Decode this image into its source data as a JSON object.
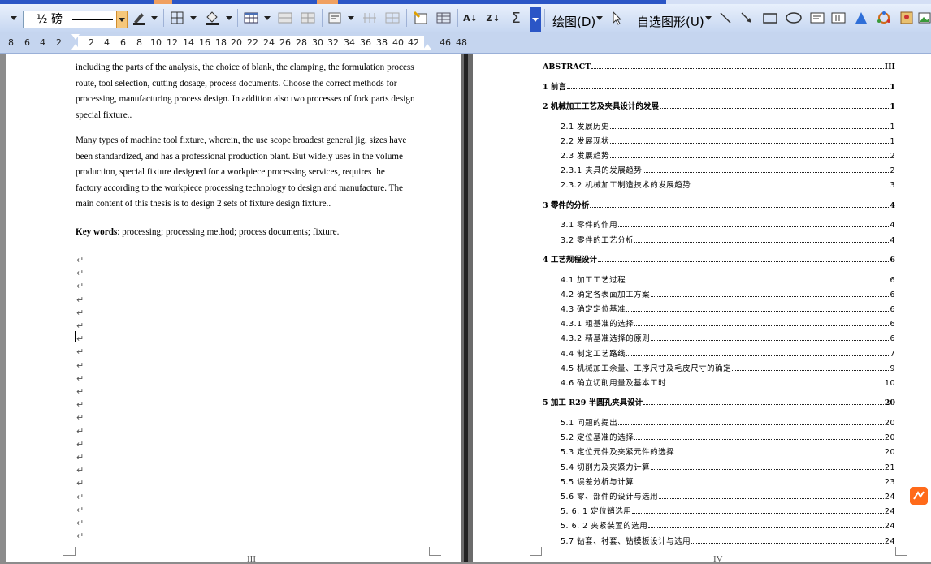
{
  "toolbar": {
    "font_size": "½ 磅",
    "draw_menu": "绘图(D)",
    "autoshapes_menu": "自选图形(U)"
  },
  "ruler": {
    "left_ticks": [
      "8",
      "6",
      "4",
      "2"
    ],
    "right_ticks": [
      "2",
      "4",
      "6",
      "8",
      "10",
      "12",
      "14",
      "16",
      "18",
      "20",
      "22",
      "24",
      "26",
      "28",
      "30",
      "32",
      "34",
      "36",
      "38",
      "40",
      "42",
      "46",
      "48"
    ]
  },
  "left_page": {
    "para1_lines": [
      "including the parts of the analysis, the choice of blank, the clamping, the formulation process",
      "route, tool selection, cutting dosage, process documents. Choose the correct methods for",
      "processing, manufacturing process design. In addition also two processes of fork parts design",
      "special fixture.."
    ],
    "para2_lines": [
      "Many types of machine tool fixture, wherein, the use scope broadest general jig, sizes have",
      "been standardized, and has a professional production plant. But widely uses in the volume",
      "production, special fixture designed for a    workpiece    processing services, requires the",
      "factory according to the    workpiece    processing technology to design and manufacture. The",
      "main content of this thesis is to design 2 sets of fixture design fixture.."
    ],
    "keywords_label": "Key words",
    "keywords_text": ": processing; processing method; process documents; fixture.",
    "return_mark": "↵",
    "page_number": "III"
  },
  "right_page": {
    "page_number": "IV",
    "toc": [
      {
        "title": "ABSTRACT",
        "page": "III",
        "level": 1
      },
      {
        "title": "1 前言",
        "page": "1",
        "level": 1
      },
      {
        "title": "2   机械加工工艺及夹具设计的发展",
        "page": "1",
        "level": 1
      },
      {
        "title": "2.1  发展历史",
        "page": "1",
        "level": 2
      },
      {
        "title": "2.2  发展现状",
        "page": "1",
        "level": 2
      },
      {
        "title": "2.3  发展趋势",
        "page": "2",
        "level": 2
      },
      {
        "title": "2.3.1 夹具的发展趋势",
        "page": "2",
        "level": 2
      },
      {
        "title": "2.3.2 机械加工制造技术的发展趋势",
        "page": "3",
        "level": 2
      },
      {
        "title": "3  零件的分析",
        "page": "4",
        "level": 1
      },
      {
        "title": "3.1  零件的作用",
        "page": "4",
        "level": 2
      },
      {
        "title": "3.2  零件的工艺分析",
        "page": "4",
        "level": 2
      },
      {
        "title": "4   工艺规程设计",
        "page": "6",
        "level": 1
      },
      {
        "title": "4.1  加工工艺过程",
        "page": "6",
        "level": 2
      },
      {
        "title": "4.2 确定各表面加工方案",
        "page": "6",
        "level": 2
      },
      {
        "title": "4.3  确定定位基准",
        "page": "6",
        "level": 2
      },
      {
        "title": "4.3.1 粗基准的选择",
        "page": "6",
        "level": 2
      },
      {
        "title": "4.3.2 精基准选择的原则",
        "page": "6",
        "level": 2
      },
      {
        "title": "4.4  制定工艺路线",
        "page": "7",
        "level": 2
      },
      {
        "title": "4.5  机械加工余量、工序尺寸及毛皮尺寸的确定",
        "page": "9",
        "level": 2
      },
      {
        "title": "4.6  确立切削用量及基本工时",
        "page": "10",
        "level": 2
      },
      {
        "title": "5  加工 R29 半圆孔夹具设计",
        "page": "20",
        "level": 1
      },
      {
        "title": "5.1 问题的提出",
        "page": "20",
        "level": 2
      },
      {
        "title": "5.2  定位基准的选择",
        "page": "20",
        "level": 2
      },
      {
        "title": "5.3  定位元件及夹紧元件的选择",
        "page": "20",
        "level": 2
      },
      {
        "title": "5.4  切削力及夹紧力计算",
        "page": "21",
        "level": 2
      },
      {
        "title": "5.5  误差分析与计算",
        "page": "23",
        "level": 2
      },
      {
        "title": "5.6  零、部件的设计与选用",
        "page": "24",
        "level": 2
      },
      {
        "title": "5. 6. 1 定位销选用",
        "page": "24",
        "level": 2
      },
      {
        "title": "5. 6. 2 夹紧装置的选用",
        "page": "24",
        "level": 2
      },
      {
        "title": "5.7  钻套、衬套、钻模板设计与选用",
        "page": "24",
        "level": 2
      }
    ]
  },
  "colors": {
    "toolbar_top": "#e8f0fc",
    "toolbar_bottom": "#c7d7f1",
    "ruler_bg": "#c5d5ef",
    "gutter": "#6b6b6b",
    "badge": "#ff6a1a"
  }
}
